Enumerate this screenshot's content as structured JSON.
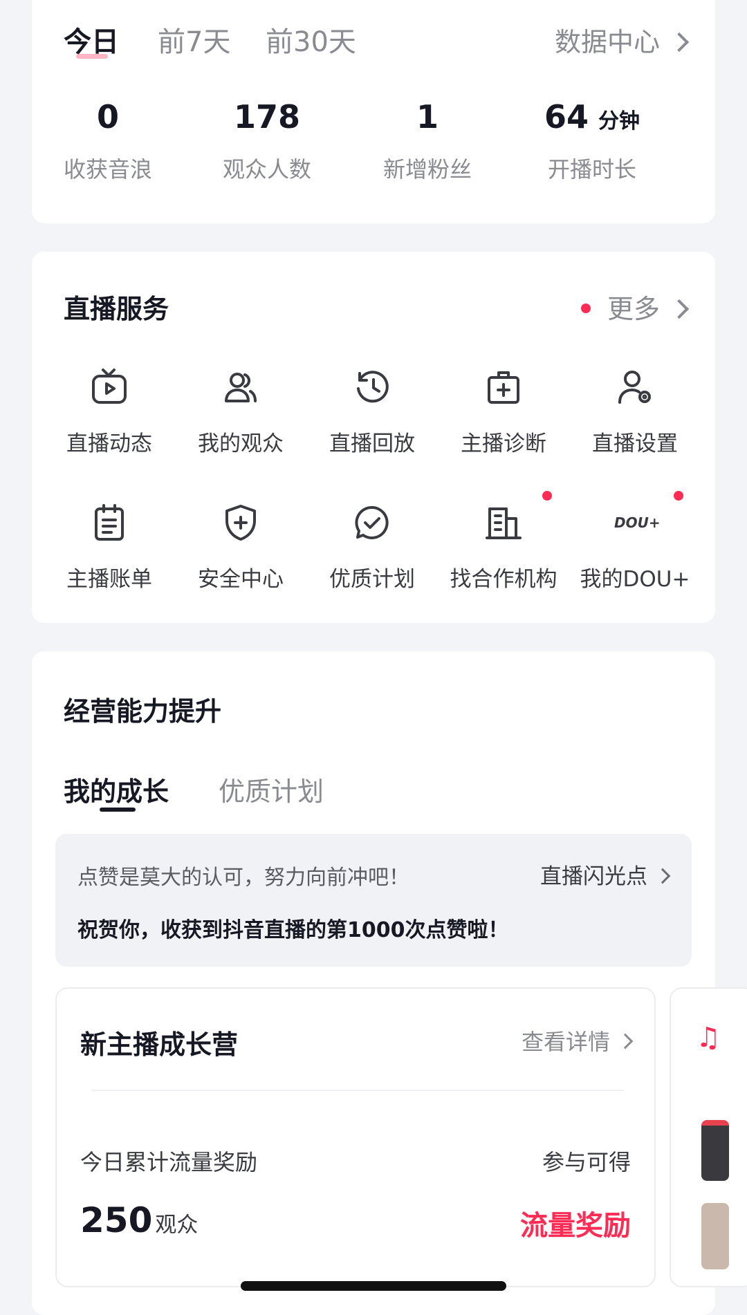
{
  "periods": {
    "today": "今日",
    "week": "前7天",
    "month": "前30天"
  },
  "data_center_label": "数据中心",
  "stats": [
    {
      "value": "0",
      "unit": "",
      "label": "收获音浪"
    },
    {
      "value": "178",
      "unit": "",
      "label": "观众人数"
    },
    {
      "value": "1",
      "unit": "",
      "label": "新增粉丝"
    },
    {
      "value": "64",
      "unit": "分钟",
      "label": "开播时长"
    }
  ],
  "live_service": {
    "title": "直播服务",
    "more_label": "更多",
    "items": [
      {
        "label": "直播动态",
        "icon": "tv-play-icon"
      },
      {
        "label": "我的观众",
        "icon": "audience-icon"
      },
      {
        "label": "直播回放",
        "icon": "history-clock-icon"
      },
      {
        "label": "主播诊断",
        "icon": "medical-kit-icon"
      },
      {
        "label": "直播设置",
        "icon": "user-settings-icon"
      },
      {
        "label": "主播账单",
        "icon": "bill-icon"
      },
      {
        "label": "安全中心",
        "icon": "shield-plus-icon"
      },
      {
        "label": "优质计划",
        "icon": "check-chat-icon"
      },
      {
        "label": "找合作机构",
        "icon": "building-icon"
      },
      {
        "label": "我的DOU+",
        "icon": "dou-plus-icon",
        "icon_text": "DOU+"
      }
    ]
  },
  "growth": {
    "title": "经营能力提升",
    "tabs": [
      "我的成长",
      "优质计划"
    ],
    "info": {
      "line1": "点赞是莫大的认可，努力向前冲吧！",
      "link": "直播闪光点",
      "line2": "祝贺你，收获到抖音直播的第1000次点赞啦！"
    },
    "camp": {
      "title": "新主播成长营",
      "link": "查看详情",
      "row_left": "今日累计流量奖励",
      "row_right": "参与可得",
      "number": "250",
      "number_unit": "观众",
      "reward": "流量奖励"
    }
  },
  "colors": {
    "accent": "#fe2c55",
    "background": "#f3f4f7",
    "card": "#ffffff"
  }
}
